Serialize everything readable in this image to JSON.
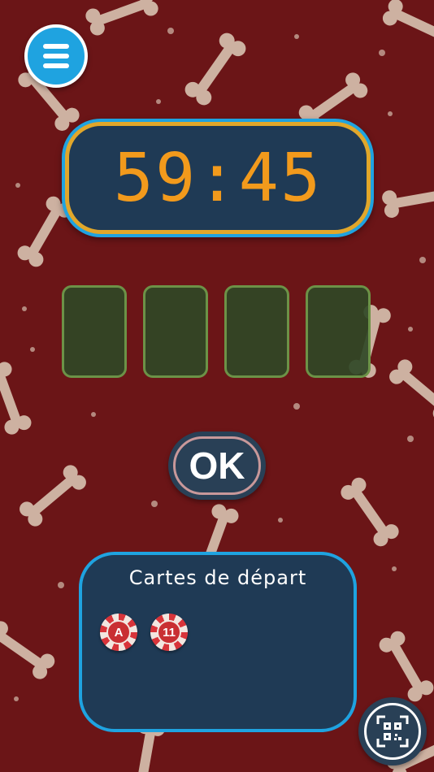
{
  "timer": {
    "value": "59:45"
  },
  "code_slots": [
    {
      "value": ""
    },
    {
      "value": ""
    },
    {
      "value": ""
    },
    {
      "value": ""
    }
  ],
  "ok_button": {
    "label": "OK"
  },
  "start_cards": {
    "title": "Cartes de départ",
    "cards": [
      {
        "label": "A"
      },
      {
        "label": "11"
      }
    ]
  },
  "icons": {
    "menu": "hamburger-menu-icon",
    "scan": "qr-code-scan-icon",
    "background": "bone-pattern"
  },
  "colors": {
    "background": "#6b1517",
    "accent_blue": "#1fa3e0",
    "panel": "#1f3a55",
    "timer_digits": "#f29a1c",
    "timer_border": "#e1a72a",
    "slot_fill": "#304826",
    "slot_border": "#6c9247",
    "chip_red": "#d8343a"
  }
}
